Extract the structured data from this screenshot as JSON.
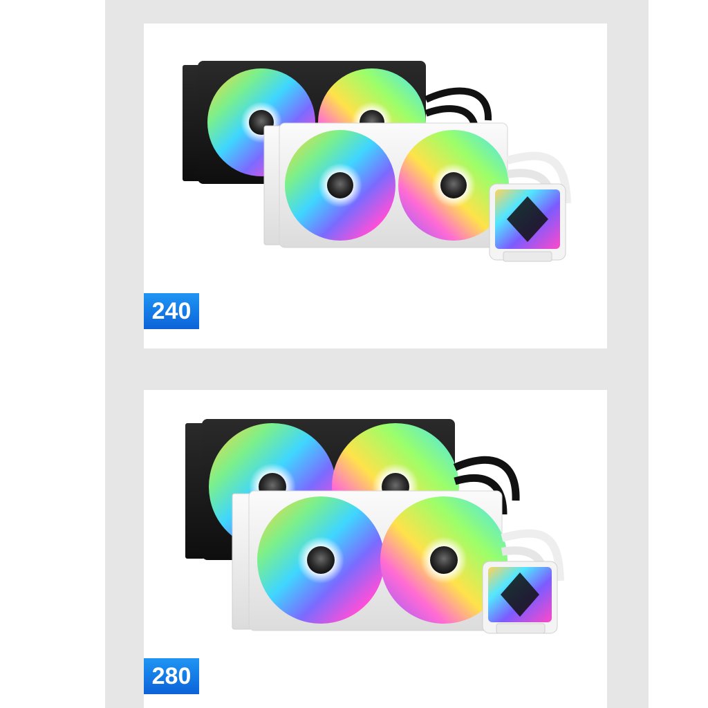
{
  "products": [
    {
      "size_label": "240",
      "badge_color": "#1a86ee"
    },
    {
      "size_label": "280",
      "badge_color": "#1a86ee"
    }
  ],
  "colors": {
    "background_strip": "#e6e6e6",
    "card": "#ffffff",
    "badge_top": "#1f95f4",
    "badge_bottom": "#0c63d8"
  }
}
